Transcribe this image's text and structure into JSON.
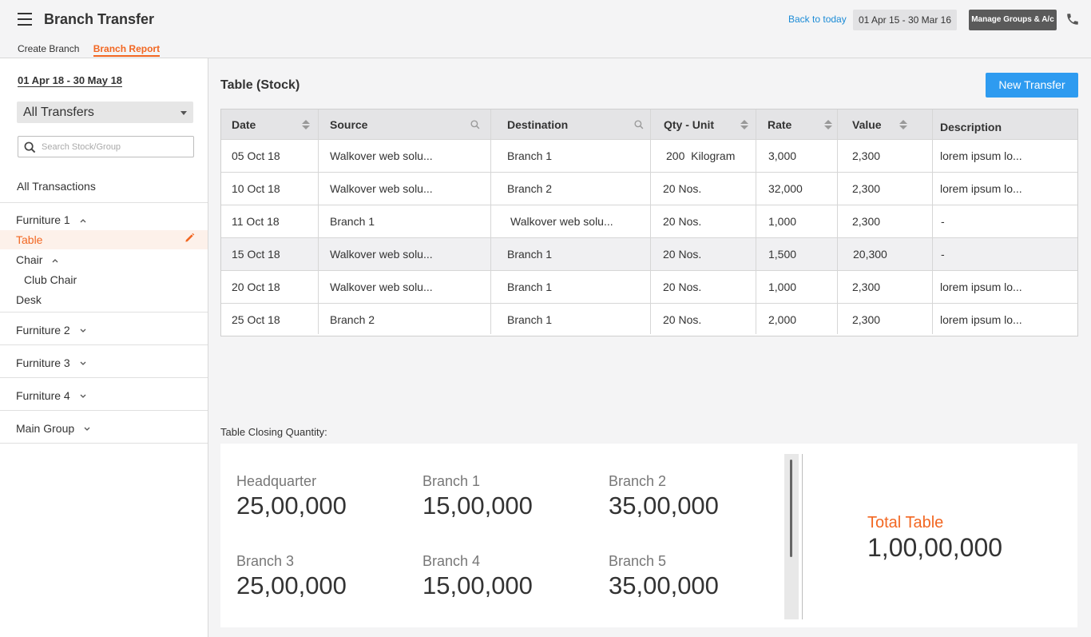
{
  "header": {
    "title": "Branch Transfer",
    "tabs": [
      {
        "label": "Create Branch"
      },
      {
        "label": "Branch Report"
      }
    ],
    "back_to_today": "Back to today",
    "date_range": "01 Apr 15 - 30 Mar 16",
    "manage_button": "Manage Groups & A/c"
  },
  "sidebar": {
    "date_range": "01 Apr 18 - 30 May 18",
    "filter_selected": "All Transfers",
    "search_placeholder": "Search Stock/Group",
    "all_transactions": "All Transactions",
    "groups": [
      {
        "label": "Furniture 1"
      },
      {
        "label": "Table"
      },
      {
        "label": "Chair"
      },
      {
        "label": "Club Chair"
      },
      {
        "label": "Desk"
      },
      {
        "label": "Furniture 2"
      },
      {
        "label": "Furniture 3"
      },
      {
        "label": "Furniture 4"
      },
      {
        "label": "Main Group"
      }
    ]
  },
  "main": {
    "title": "Table (Stock)",
    "new_button": "New Transfer",
    "columns": [
      "Date",
      "Source",
      "Destination",
      "Qty - Unit",
      "Rate",
      "Value",
      "Description"
    ],
    "rows": [
      [
        "05 Oct 18",
        "Walkover web solu...",
        "Branch 1",
        "200  Kilogram",
        "3,000",
        "2,300",
        "lorem ipsum lo..."
      ],
      [
        "10 Oct 18",
        "Walkover web solu...",
        "Branch 2",
        "20 Nos.",
        "32,000",
        "2,300",
        "lorem ipsum lo..."
      ],
      [
        "11 Oct 18",
        "Branch 1",
        "Walkover web solu...",
        "20 Nos.",
        "1,000",
        "2,300",
        "-"
      ],
      [
        "15 Oct 18",
        "Walkover web solu...",
        "Branch 1",
        "20 Nos.",
        "1,500",
        "20,300",
        "-"
      ],
      [
        "20 Oct 18",
        "Walkover web solu...",
        "Branch 1",
        "20 Nos.",
        "1,000",
        "2,300",
        "lorem ipsum lo..."
      ],
      [
        "25 Oct 18",
        "Branch 2",
        "Branch 1",
        "20 Nos.",
        "2,000",
        "2,300",
        "lorem ipsum lo..."
      ]
    ],
    "closing_label": "Table Closing Quantity:",
    "closing": [
      {
        "label": "Headquarter",
        "value": "25,00,000"
      },
      {
        "label": "Branch 1",
        "value": "15,00,000"
      },
      {
        "label": "Branch 2",
        "value": "35,00,000"
      },
      {
        "label": "Branch 3",
        "value": "25,00,000"
      },
      {
        "label": "Branch 4",
        "value": "15,00,000"
      },
      {
        "label": "Branch 5",
        "value": "35,00,000"
      }
    ],
    "total_label": "Total Table",
    "total_value": "1,00,00,000"
  },
  "colors": {
    "accent": "#f26722",
    "primary": "#2e9bf0",
    "link": "#1b8bd6"
  },
  "icons": [
    "menu-icon",
    "phone-icon",
    "caret-down-icon",
    "search-icon",
    "chevron-up-icon",
    "chevron-down-icon",
    "edit-icon",
    "sort-icon"
  ]
}
